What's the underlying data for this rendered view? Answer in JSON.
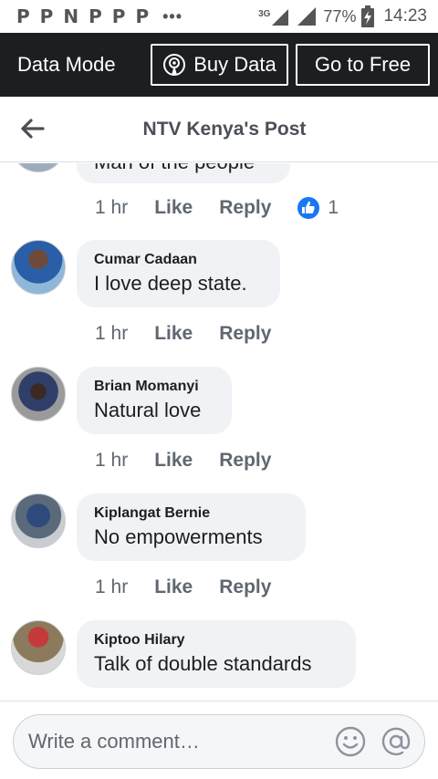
{
  "status_bar": {
    "notifications": [
      "P",
      "P",
      "N",
      "P",
      "P",
      "P"
    ],
    "more": "•••",
    "network": "3G",
    "battery": "77%",
    "time": "14:23"
  },
  "data_bar": {
    "label": "Data Mode",
    "buy_data": "Buy Data",
    "go_free": "Go to Free"
  },
  "header": {
    "title": "NTV Kenya's Post"
  },
  "comments": [
    {
      "author": "",
      "text": "Man of the people",
      "age": "1 hr",
      "like": "Like",
      "reply": "Reply",
      "reactions": "1"
    },
    {
      "author": "Cumar Cadaan",
      "text": "I love deep state.",
      "age": "1 hr",
      "like": "Like",
      "reply": "Reply"
    },
    {
      "author": "Brian Momanyi",
      "text": "Natural love",
      "age": "1 hr",
      "like": "Like",
      "reply": "Reply"
    },
    {
      "author": "Kiplangat Bernie",
      "text": "No empowerments",
      "age": "1 hr",
      "like": "Like",
      "reply": "Reply"
    },
    {
      "author": "Kiptoo Hilary",
      "text": "Talk of double standards"
    }
  ],
  "composer": {
    "placeholder": "Write a comment…",
    "emoji_icon": "smiley-icon",
    "mention_icon": "at-sign-icon"
  },
  "colors": {
    "data_bar_bg": "#1c1e21",
    "like_blue": "#1877f2",
    "bubble_bg": "#f0f2f5"
  }
}
